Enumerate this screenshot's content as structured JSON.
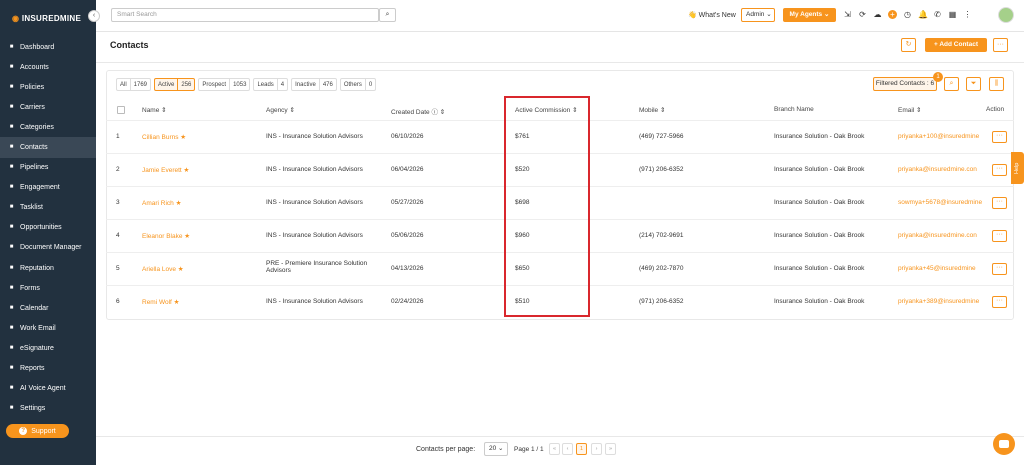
{
  "brand": {
    "logo_text": "INSUREDMINE",
    "accent": "#f7941d",
    "sidebar_bg": "#22313f"
  },
  "sidebar": {
    "items": [
      {
        "label": "Dashboard",
        "icon": "dashboard-icon"
      },
      {
        "label": "Accounts",
        "icon": "accounts-icon"
      },
      {
        "label": "Policies",
        "icon": "policies-icon"
      },
      {
        "label": "Carriers",
        "icon": "carriers-icon"
      },
      {
        "label": "Categories",
        "icon": "categories-icon"
      },
      {
        "label": "Contacts",
        "icon": "contacts-icon",
        "active": true
      },
      {
        "label": "Pipelines",
        "icon": "pipelines-icon"
      },
      {
        "label": "Engagement",
        "icon": "engagement-icon"
      },
      {
        "label": "Tasklist",
        "icon": "tasklist-icon"
      },
      {
        "label": "Opportunities",
        "icon": "opportunities-icon"
      },
      {
        "label": "Document Manager",
        "icon": "folder-icon"
      },
      {
        "label": "Reputation",
        "icon": "reputation-icon"
      },
      {
        "label": "Forms",
        "icon": "forms-icon"
      },
      {
        "label": "Calendar",
        "icon": "calendar-icon"
      },
      {
        "label": "Work Email",
        "icon": "email-icon"
      },
      {
        "label": "eSignature",
        "icon": "signature-icon"
      },
      {
        "label": "Reports",
        "icon": "reports-icon"
      },
      {
        "label": "AI Voice Agent",
        "icon": "voice-agent-icon"
      },
      {
        "label": "Settings",
        "icon": "gear-icon"
      }
    ],
    "support_label": "Support"
  },
  "topbar": {
    "search_placeholder": "Smart Search",
    "whats_new": "What's New",
    "admin_label": "Admin",
    "my_agents_label": "My Agents"
  },
  "header": {
    "title": "Contacts",
    "add_contact_label": "+ Add Contact"
  },
  "filters": [
    {
      "label": "All",
      "count": "1769"
    },
    {
      "label": "Active",
      "count": "256",
      "active": true
    },
    {
      "label": "Prospect",
      "count": "1053"
    },
    {
      "label": "Leads",
      "count": "4"
    },
    {
      "label": "Inactive",
      "count": "476"
    },
    {
      "label": "Others",
      "count": "0"
    }
  ],
  "filtered_contacts_label": "Filtered Contacts : 6",
  "filter_badge": "1",
  "table": {
    "columns": [
      "Name ⇕",
      "Agency ⇕",
      "Created Date ⓘ ⇕",
      "Active Commission ⇕",
      "Mobile ⇕",
      "Branch Name",
      "Email ⇕",
      "Action"
    ],
    "rows": [
      {
        "num": "1",
        "name": "Cillian Burns",
        "agency": "INS - Insurance Solution Advisors",
        "date": "06/10/2026",
        "commission": "$761",
        "mobile": "(469) 727-5966",
        "branch": "Insurance Solution - Oak Brook",
        "email": "priyanka+100@insuredmine"
      },
      {
        "num": "2",
        "name": "Jamie Everett",
        "agency": "INS - Insurance Solution Advisors",
        "date": "06/04/2026",
        "commission": "$520",
        "mobile": "(971) 206-6352",
        "branch": "Insurance Solution - Oak Brook",
        "email": "priyanka@insuredmine.con"
      },
      {
        "num": "3",
        "name": "Amari Rich",
        "agency": "INS - Insurance Solution Advisors",
        "date": "05/27/2026",
        "commission": "$698",
        "mobile": "",
        "branch": "Insurance Solution - Oak Brook",
        "email": "sowmya+5678@insuredmine"
      },
      {
        "num": "4",
        "name": "Eleanor Blake",
        "agency": "INS - Insurance Solution Advisors",
        "date": "05/06/2026",
        "commission": "$960",
        "mobile": "(214) 702-9691",
        "branch": "Insurance Solution - Oak Brook",
        "email": "priyanka@insuredmine.con"
      },
      {
        "num": "5",
        "name": "Ariella Love",
        "agency": "PRE - Premiere Insurance Solution",
        "agency2": "Advisors",
        "date": "04/13/2026",
        "commission": "$650",
        "mobile": "(469) 202-7870",
        "branch": "Insurance Solution - Oak Brook",
        "email": "priyanka+45@insuredmine"
      },
      {
        "num": "6",
        "name": "Remi Wolf",
        "agency": "INS - Insurance Solution Advisors",
        "date": "02/24/2026",
        "commission": "$510",
        "mobile": "(971) 206-6352",
        "branch": "Insurance Solution - Oak Brook",
        "email": "priyanka+389@insuredmine"
      }
    ]
  },
  "pager": {
    "per_page_label": "Contacts per page:",
    "per_page": "20",
    "page_info": "Page 1 / 1",
    "current": "1"
  },
  "help_label": "Help"
}
